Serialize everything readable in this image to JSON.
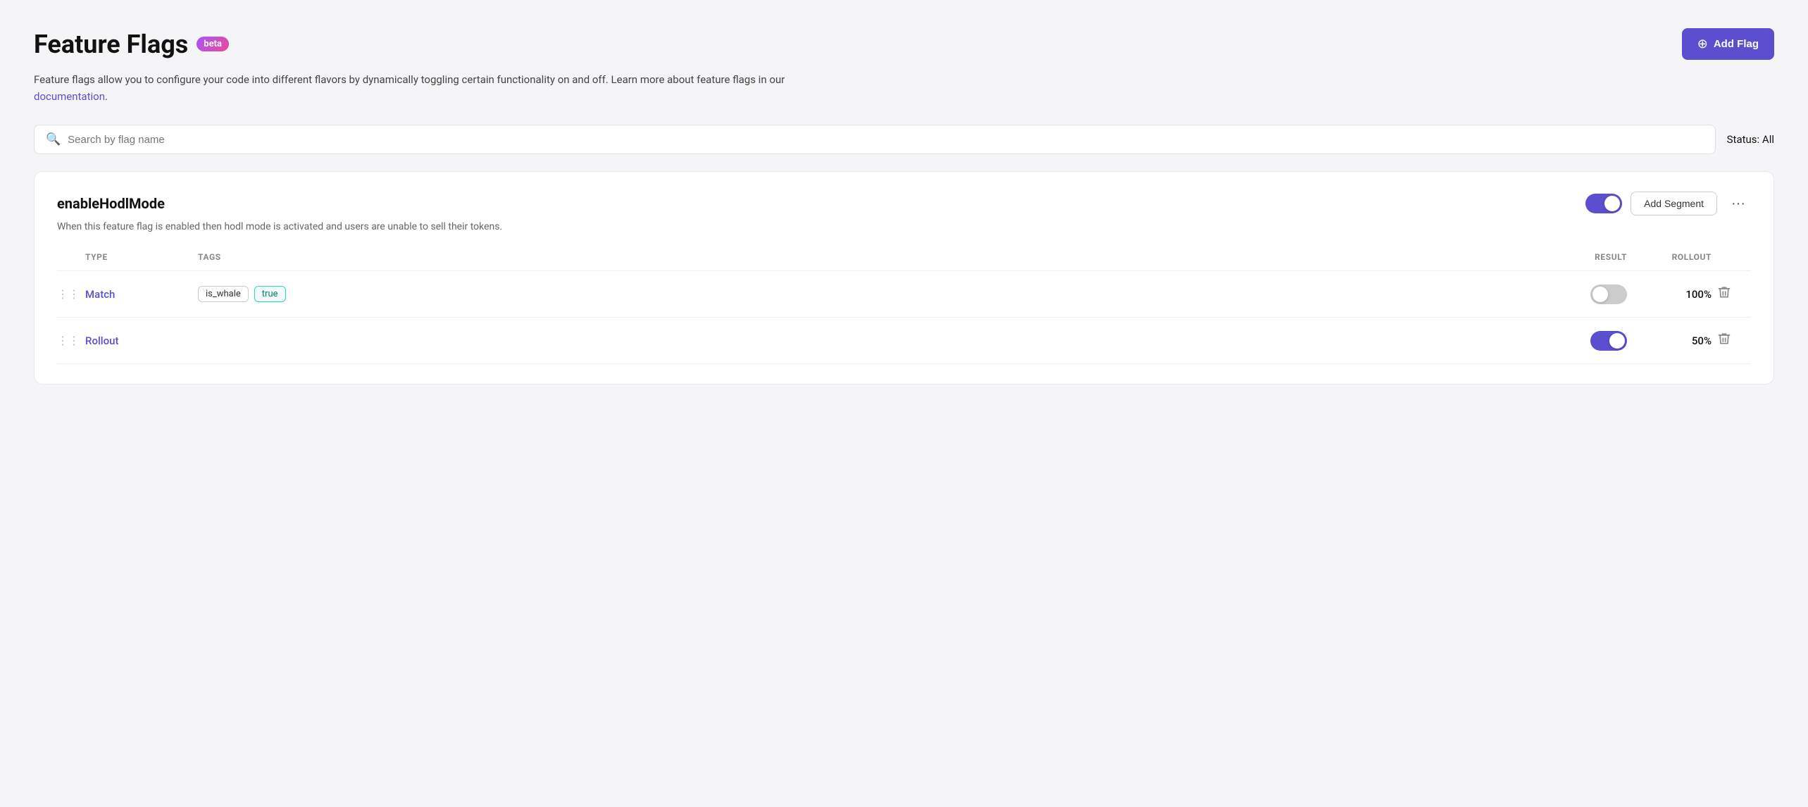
{
  "page": {
    "title": "Feature Flags",
    "beta_label": "beta",
    "description_text": "Feature flags allow you to configure your code into different flavors by dynamically toggling certain functionality on and off. Learn more about feature flags in our",
    "description_link_text": "documentation",
    "description_suffix": ".",
    "add_flag_label": "Add Flag",
    "search_placeholder": "Search by flag name",
    "status_label": "Status:",
    "status_value": "All"
  },
  "flag": {
    "name": "enableHodlMode",
    "description": "When this feature flag is enabled then hodl mode is activated and users are unable to sell their tokens.",
    "toggle_state": "on",
    "add_segment_label": "Add Segment",
    "more_options_label": "•••"
  },
  "segments": {
    "columns": {
      "type": "TYPE",
      "tags": "TAGS",
      "result": "RESULT",
      "rollout": "ROLLOUT"
    },
    "rows": [
      {
        "id": 1,
        "type": "Match",
        "tags": [
          {
            "label": "is_whale",
            "highlighted": false
          },
          {
            "label": "true",
            "highlighted": true
          }
        ],
        "toggle_state": "off",
        "rollout": "100%"
      },
      {
        "id": 2,
        "type": "Rollout",
        "tags": [],
        "toggle_state": "on",
        "rollout": "50%"
      }
    ]
  }
}
